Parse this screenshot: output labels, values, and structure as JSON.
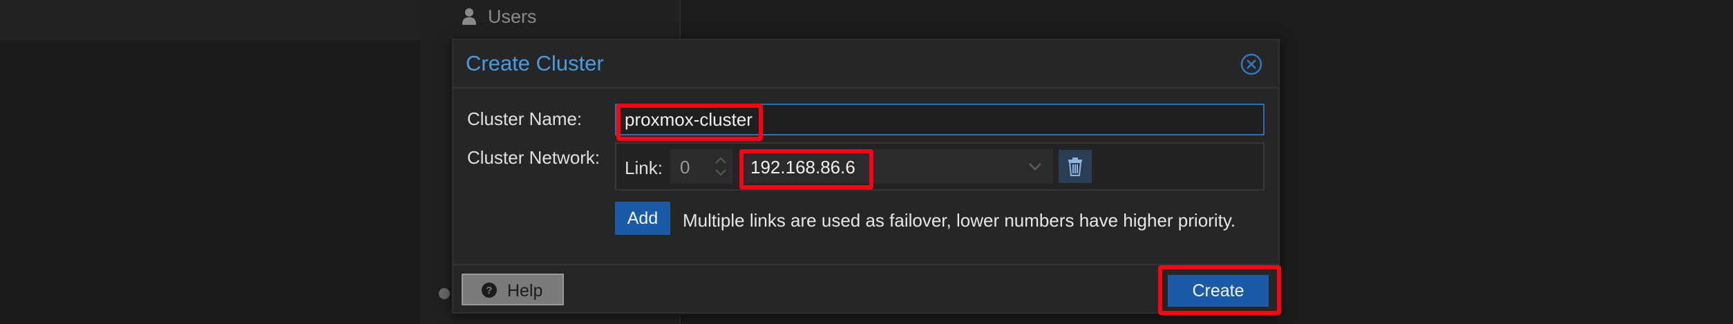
{
  "background": {
    "nav_item_label": "Users",
    "nav_item_icon": "user-icon"
  },
  "dialog": {
    "title": "Create Cluster",
    "close_icon": "close-circle-icon",
    "cluster_name_label": "Cluster Name:",
    "cluster_name_value": "proxmox-cluster",
    "cluster_network_label": "Cluster Network:",
    "link_label": "Link:",
    "link_number": "0",
    "link_address": "192.168.86.6",
    "trash_icon": "trash-icon",
    "add_label": "Add",
    "add_hint": "Multiple links are used as failover, lower numbers have higher priority.",
    "help_label": "Help",
    "help_icon": "question-circle-icon",
    "create_label": "Create"
  },
  "colors": {
    "accent_blue": "#1b5aa6",
    "title_blue": "#4c9ae0",
    "highlight_red": "#ff0014"
  }
}
